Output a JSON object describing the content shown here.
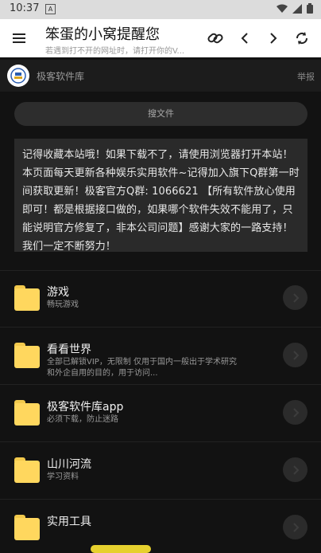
{
  "status": {
    "time": "10:37",
    "sim_label": "A"
  },
  "header": {
    "title": "笨蛋的小窝提醒您",
    "subtitle": "若遇到打不开的网址时，请打开你的V..."
  },
  "site": {
    "name": "极客软件库",
    "report": "举报"
  },
  "search": {
    "label": "搜文件"
  },
  "notice": {
    "text": "记得收藏本站哦！如果下载不了，请使用浏览器打开本站！本页面每天更新各种娱乐实用软件~记得加入旗下Q群第一时间获取更新！极客官方Q群: 1066621 【所有软件放心使用即可！都是根据接口做的，如果哪个软件失效不能用了，只能说明官方修复了，非本公司问题】感谢大家的一路支持！我们一定不断努力！"
  },
  "folders": [
    {
      "title": "游戏",
      "subtitle": "畅玩游戏"
    },
    {
      "title": "看看世界",
      "subtitle": "全部已解锁VIP，无限制 仅用于国内一般出于学术研究和外企自用的目的，用于访问..."
    },
    {
      "title": "极客软件库app",
      "subtitle": "必须下载，防止迷路"
    },
    {
      "title": "山川河流",
      "subtitle": "学习资料"
    },
    {
      "title": "实用工具",
      "subtitle": ""
    }
  ],
  "colors": {
    "folder": "#ffd75e",
    "background": "#121212",
    "accent_pill": "#e6d02e"
  }
}
